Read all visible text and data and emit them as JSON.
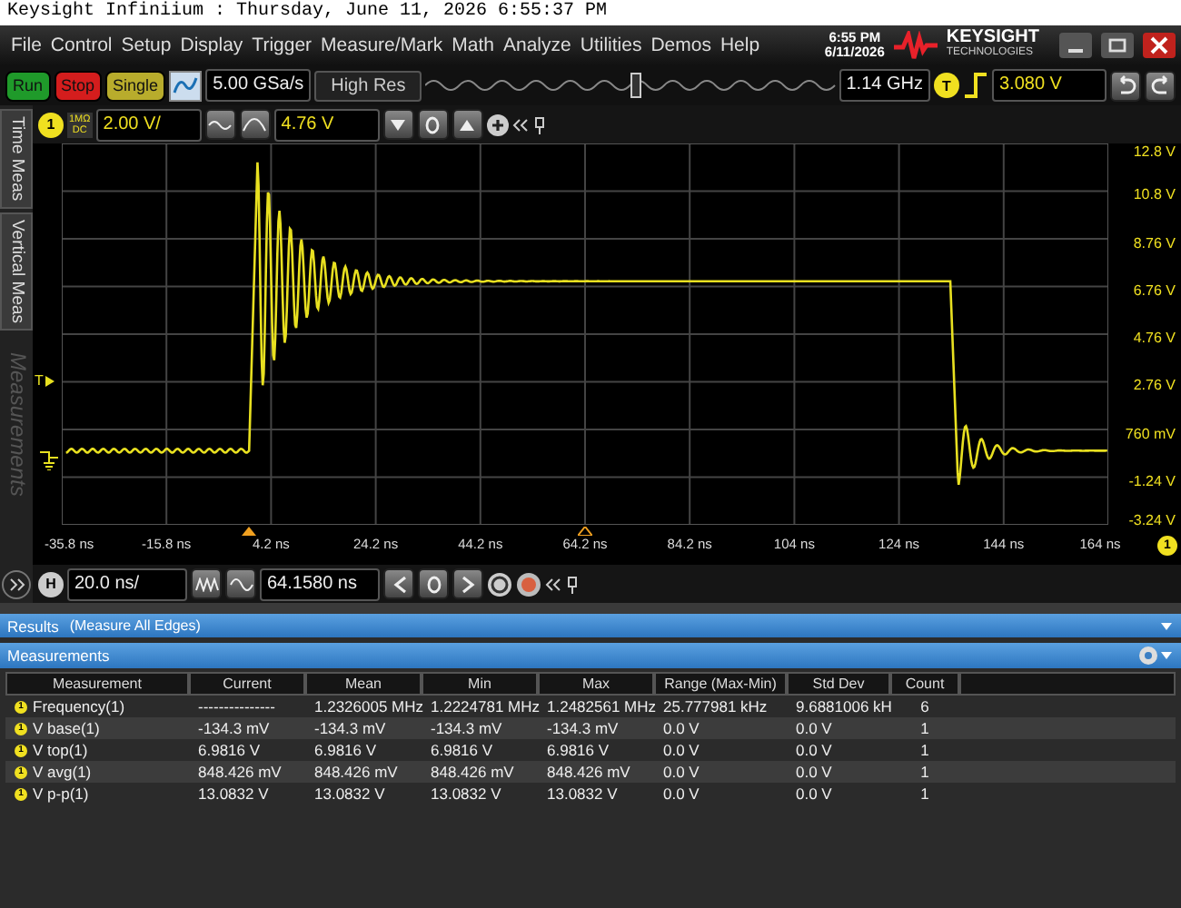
{
  "title_bar": {
    "text": "Keysight Infiniium : Thursday, June 11, 2026 6:55:37 PM"
  },
  "menu": [
    "File",
    "Control",
    "Setup",
    "Display",
    "Trigger",
    "Measure/Mark",
    "Math",
    "Analyze",
    "Utilities",
    "Demos",
    "Help"
  ],
  "clock": {
    "time": "6:55 PM",
    "date": "6/11/2026"
  },
  "logo": {
    "name": "KEYSIGHT",
    "tagline": "TECHNOLOGIES"
  },
  "acquisition_buttons": [
    {
      "label": "Run",
      "kind": "run"
    },
    {
      "label": "Stop",
      "kind": "stop"
    },
    {
      "label": "Single",
      "kind": "single"
    }
  ],
  "delay_slider": {
    "level": 0.5
  },
  "sample_rate": "5.00 GSa/s",
  "acquisition_mode": "High Res",
  "bandwidth": "1.14 GHz",
  "trigger": {
    "badge": "T",
    "level": "3.080 V"
  },
  "side_tabs": [
    {
      "label": "Time Meas",
      "disabled": false
    },
    {
      "label": "Vertical Meas",
      "disabled": false
    },
    {
      "label": "Measurements",
      "disabled": true
    }
  ],
  "channel": {
    "badge": "1",
    "impedance": "1MΩ",
    "coupling": "DC",
    "scale": "2.00 V/",
    "offset": "4.76 V"
  },
  "trigger_marker": "T",
  "y_labels": [
    "12.8 V",
    "10.8 V",
    "8.76 V",
    "6.76 V",
    "4.76 V",
    "2.76 V",
    "760 mV",
    "-1.24 V",
    "-3.24 V"
  ],
  "x_labels": [
    "-35.8 ns",
    "-15.8 ns",
    "4.2 ns",
    "24.2 ns",
    "44.2 ns",
    "64.2 ns",
    "84.2 ns",
    "104 ns",
    "124 ns",
    "144 ns",
    "164 ns"
  ],
  "channel_indicator": "1",
  "horizontal": {
    "badge": "H",
    "scale": "20.0 ns/",
    "position": "64.1580 ns"
  },
  "results": {
    "title": "Results",
    "subtitle": "(Measure All Edges)"
  },
  "measurements": {
    "title": "Measurements",
    "columns": [
      "Measurement",
      "Current",
      "Mean",
      "Min",
      "Max",
      "Range (Max-Min)",
      "Std Dev",
      "Count"
    ],
    "rows": [
      {
        "source": "1",
        "cells": [
          "Frequency(1)",
          "---------------",
          "1.2326005 MHz",
          "1.2224781 MHz",
          "1.2482561 MHz",
          "25.777981 kHz",
          "9.6881006 kH",
          "6"
        ]
      },
      {
        "source": "1",
        "cells": [
          "V base(1)",
          "-134.3 mV",
          "-134.3 mV",
          "-134.3 mV",
          "-134.3 mV",
          "0.0 V",
          "0.0 V",
          "1"
        ]
      },
      {
        "source": "1",
        "cells": [
          "V top(1)",
          "6.9816 V",
          "6.9816 V",
          "6.9816 V",
          "6.9816 V",
          "0.0 V",
          "0.0 V",
          "1"
        ]
      },
      {
        "source": "1",
        "cells": [
          "V avg(1)",
          "848.426 mV",
          "848.426 mV",
          "848.426 mV",
          "848.426 mV",
          "0.0 V",
          "0.0 V",
          "1"
        ]
      },
      {
        "source": "1",
        "cells": [
          "V p-p(1)",
          "13.0832 V",
          "13.0832 V",
          "13.0832 V",
          "13.0832 V",
          "0.0 V",
          "0.0 V",
          "1"
        ]
      }
    ]
  }
}
